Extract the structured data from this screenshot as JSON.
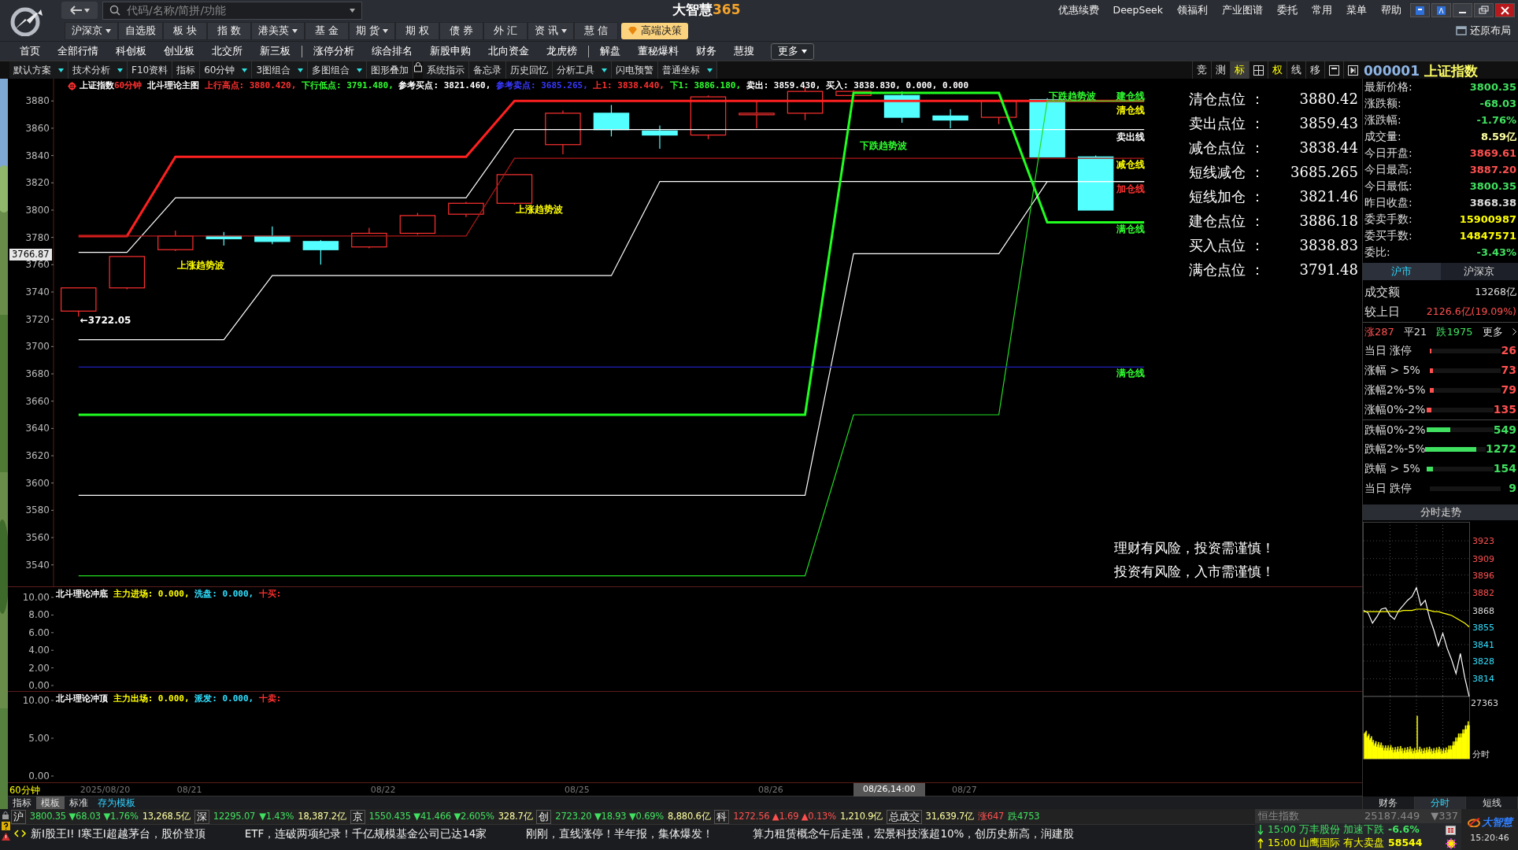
{
  "app_title": "大智慧",
  "app_title_suffix": "365",
  "search": {
    "placeholder": "代码/名称/简拼/功能"
  },
  "top_links": [
    "优惠续费",
    "DeepSeek",
    "领福利",
    "产业图谱",
    "委托",
    "常用",
    "菜单",
    "帮助"
  ],
  "restore_layout": "还原布局",
  "main_menu": [
    {
      "label": "沪深京",
      "dropdown": true
    },
    {
      "label": "自选股",
      "dropdown": false
    },
    {
      "label": "板 块",
      "dropdown": false
    },
    {
      "label": "指 数",
      "dropdown": false
    },
    {
      "label": "港美英",
      "dropdown": true
    },
    {
      "label": "基 金",
      "dropdown": false
    },
    {
      "label": "期 货",
      "dropdown": true
    },
    {
      "label": "期 权",
      "dropdown": false
    },
    {
      "label": "债 券",
      "dropdown": false
    },
    {
      "label": "外 汇",
      "dropdown": false
    },
    {
      "label": "资 讯",
      "dropdown": true
    },
    {
      "label": "慧 信",
      "dropdown": false
    }
  ],
  "premium_button": "高端决策",
  "nav": [
    {
      "kind": "link",
      "label": "首页"
    },
    {
      "kind": "link",
      "label": "全部行情"
    },
    {
      "kind": "link",
      "label": "科创板"
    },
    {
      "kind": "link",
      "label": "创业板"
    },
    {
      "kind": "link",
      "label": "北交所"
    },
    {
      "kind": "link",
      "label": "新三板"
    },
    {
      "kind": "separator"
    },
    {
      "kind": "link",
      "label": "涨停分析"
    },
    {
      "kind": "link",
      "label": "综合排名"
    },
    {
      "kind": "link",
      "label": "新股申购"
    },
    {
      "kind": "link",
      "label": "北向资金"
    },
    {
      "kind": "link",
      "label": "龙虎榜"
    },
    {
      "kind": "separator"
    },
    {
      "kind": "link",
      "label": "解盘"
    },
    {
      "kind": "link",
      "label": "董秘爆料"
    },
    {
      "kind": "link",
      "label": "财务"
    },
    {
      "kind": "link",
      "label": "慧搜"
    }
  ],
  "more_button": "更多",
  "toolbar": [
    {
      "kind": "button",
      "label": "默认方案",
      "dropdown": true
    },
    {
      "kind": "button",
      "label": "技术分析",
      "dropdown": true
    },
    {
      "kind": "button",
      "label": "F10资料",
      "dropdown": false
    },
    {
      "kind": "button",
      "label": "指标",
      "dropdown": false
    },
    {
      "kind": "button",
      "label": "60分钟",
      "dropdown": true
    },
    {
      "kind": "button",
      "label": "3图组合",
      "dropdown": true
    },
    {
      "kind": "button",
      "label": "多图组合",
      "dropdown": true
    },
    {
      "kind": "button",
      "label": "图形叠加",
      "dropdown": false
    },
    {
      "kind": "lock"
    },
    {
      "kind": "button",
      "label": "系统指示",
      "dropdown": false
    },
    {
      "kind": "button",
      "label": "备忘录",
      "dropdown": false
    },
    {
      "kind": "button",
      "label": "历史回忆",
      "dropdown": false
    },
    {
      "kind": "button",
      "label": "分析工具",
      "dropdown": true
    },
    {
      "kind": "button",
      "label": "闪电预警",
      "dropdown": false
    },
    {
      "kind": "button",
      "label": "普通坐标",
      "dropdown": true
    }
  ],
  "view_buttons": [
    {
      "kind": "text",
      "label": "竞",
      "selected": false,
      "active": false
    },
    {
      "kind": "text",
      "label": "测",
      "selected": false,
      "active": false
    },
    {
      "kind": "text",
      "label": "标",
      "selected": true,
      "active": true
    },
    {
      "kind": "grid"
    },
    {
      "kind": "text",
      "label": "权",
      "selected": false,
      "active": true
    },
    {
      "kind": "text",
      "label": "线",
      "selected": false,
      "active": false
    },
    {
      "kind": "text",
      "label": "移",
      "selected": false,
      "active": false
    },
    {
      "kind": "window"
    },
    {
      "kind": "panel"
    }
  ],
  "stock_title": {
    "code": "000001",
    "name": "上证指数"
  },
  "main_chart": {
    "legend": [
      {
        "text": "上证指数",
        "color": "#ffffff"
      },
      {
        "text": "60分钟",
        "color": "#ff3030"
      },
      {
        "text": " 北斗理论主图 ",
        "color": "#ffffff"
      },
      {
        "text": "上行高点: 3880.420, ",
        "color": "#ff3030"
      },
      {
        "text": "下行低点: 3791.480, ",
        "color": "#30ff30"
      },
      {
        "text": "参考买点: 3821.460, ",
        "color": "#ffffff"
      },
      {
        "text": "参考卖点: 3685.265, ",
        "color": "#3838ff"
      },
      {
        "text": "上1: 3838.440, ",
        "color": "#ff3030"
      },
      {
        "text": "下1: 3886.180, ",
        "color": "#30ff30"
      },
      {
        "text": "卖出: 3859.430, ",
        "color": "#ffffff"
      },
      {
        "text": "买入: 3838.830, 0.000, 0.000",
        "color": "#ffffff"
      }
    ],
    "cursor": {
      "price": "3766.87",
      "time": "08/26,14:00"
    },
    "levels": [
      {
        "label": "清仓点位 ：",
        "value": "3880.42"
      },
      {
        "label": "卖出点位 ：",
        "value": "3859.43"
      },
      {
        "label": "减仓点位 ：",
        "value": "3838.44"
      },
      {
        "label": "短线减仓 ：",
        "value": "3685.265"
      },
      {
        "label": "短线加仓 ：",
        "value": "3821.46"
      },
      {
        "label": "建仓点位 ：",
        "value": "3886.18"
      },
      {
        "label": "买入点位 ：",
        "value": "3838.83"
      },
      {
        "label": "满仓点位 ：",
        "value": "3791.48"
      }
    ],
    "time_labels": [
      "2025/08/20",
      "08/21",
      "08/22",
      "08/25",
      "08/26",
      "08/27"
    ],
    "warnings": [
      "理财有风险，投资需谨慎！",
      "投资有风险，入市需谨慎！"
    ],
    "labels": [
      {
        "text": "←3722.05",
        "color": "#ffffff"
      },
      {
        "text": "上涨趋势波",
        "color": "#ffff00"
      },
      {
        "text": "上涨趋势波",
        "color": "#ffff00"
      },
      {
        "text": "下跌趋势波",
        "color": "#30ff30"
      },
      {
        "text": "下跌趋势波",
        "color": "#30ff30"
      },
      {
        "text": "建仓线",
        "color": "#30ff30"
      },
      {
        "text": "清仓线",
        "color": "#ffff00"
      },
      {
        "text": "卖出线",
        "color": "#ffffff"
      },
      {
        "text": "减仓线",
        "color": "#ffff00"
      },
      {
        "text": "加仓线",
        "color": "#ff3030"
      },
      {
        "text": "满仓线",
        "color": "#30ff30"
      },
      {
        "text": "满仓线",
        "color": "#30ff30"
      }
    ],
    "chart_data": {
      "type": "line",
      "categories": [
        null,
        null,
        null,
        null,
        null,
        null,
        null,
        null,
        null,
        null,
        null,
        null,
        null,
        null,
        null,
        null,
        null,
        null,
        null,
        null,
        null,
        null,
        null,
        null,
        null,
        null,
        null
      ],
      "ylim": [
        3523.7,
        3896.3
      ],
      "yticks": [
        3540,
        3560,
        3580,
        3600,
        3620,
        3640,
        3660,
        3680,
        3700,
        3720,
        3740,
        3760,
        3780,
        3800,
        3820,
        3840,
        3860,
        3880
      ],
      "series": [
        {
          "color": "#ff2020",
          "values": [
            3781,
            3781,
            3839,
            3839,
            3839,
            3839,
            3839,
            3839,
            3839,
            3880,
            3880,
            3880,
            3880,
            3880,
            3880,
            3880,
            3880,
            3880,
            3880,
            3880,
            3880,
            3880,
            3880,
            null,
            null,
            null,
            null
          ]
        },
        {
          "color": "#ffffff",
          "values": [
            3769,
            3769,
            3809,
            3809,
            3809,
            3809,
            3809,
            3809,
            3809,
            3859,
            3859,
            3859,
            3859,
            3859,
            3859,
            3859,
            3859,
            3859,
            3859,
            3859,
            3859,
            3859,
            3859,
            null,
            null,
            null,
            null
          ]
        },
        {
          "color": "#b01818",
          "values": [
            3781,
            3781,
            3781,
            3781,
            3781,
            3781,
            3781,
            3781,
            3781,
            3838,
            3838,
            3838,
            3838,
            3838,
            3838,
            3838,
            3838,
            3838,
            3838,
            3838,
            3838,
            3838,
            3838,
            null,
            null,
            null,
            null
          ]
        },
        {
          "color": "#ffffff",
          "values": [
            3705,
            3705,
            3705,
            3705,
            3752,
            3752,
            3752,
            3752,
            3752,
            3752,
            3752,
            3752,
            3821,
            3821,
            3821,
            3821,
            3821,
            3821,
            3821,
            3821,
            3821,
            3821,
            3821,
            null,
            null,
            null,
            null
          ]
        },
        {
          "color": "#20ff20",
          "values": [
            3650,
            3650,
            3650,
            3650,
            3650,
            3650,
            3650,
            3650,
            3650,
            3650,
            3650,
            3650,
            3650,
            3650,
            3650,
            3650,
            3886,
            3886,
            3886,
            3886,
            3791,
            3791,
            3791,
            null,
            null,
            null,
            null
          ]
        },
        {
          "color": "#ffffff",
          "values": [
            3591,
            3591,
            3591,
            3591,
            3591,
            3591,
            3591,
            3591,
            3591,
            3591,
            3591,
            3591,
            3591,
            3591,
            3591,
            3591,
            3768,
            3768,
            3768,
            3768,
            3821,
            3821,
            3821,
            null,
            null,
            null,
            null
          ]
        },
        {
          "color": "#20e020",
          "values": [
            3532,
            3532,
            3532,
            3532,
            3532,
            3532,
            3532,
            3532,
            3532,
            3532,
            3532,
            3532,
            3532,
            3532,
            3532,
            3532,
            3650,
            3650,
            3650,
            3650,
            3880,
            3880,
            3880,
            null,
            null,
            null,
            null
          ]
        },
        {
          "color": "#2020c0",
          "values": [
            3685,
            3685,
            3685,
            3685,
            3685,
            3685,
            3685,
            3685,
            3685,
            3685,
            3685,
            3685,
            3685,
            3685,
            3685,
            3685,
            3685,
            3685,
            3685,
            3685,
            3685,
            3685,
            3685,
            null,
            null,
            null,
            null
          ]
        }
      ]
    }
  },
  "indicators": [
    {
      "legend": [
        {
          "text": "北斗理论冲底 ",
          "color": "#ffffff"
        },
        {
          "text": "主力进场: 0.000, ",
          "color": "#ffff00"
        },
        {
          "text": "洗盘: 0.000, ",
          "color": "#30e0ff"
        },
        {
          "text": "十买:",
          "color": "#ff3030"
        }
      ],
      "axis_labels": [
        "10.00",
        "8.00",
        "6.00",
        "4.00",
        "2.00",
        "0.00"
      ]
    },
    {
      "legend": [
        {
          "text": "北斗理论冲顶 ",
          "color": "#ffffff"
        },
        {
          "text": "主力出场: 0.000, ",
          "color": "#ffff00"
        },
        {
          "text": "派发: 0.000, ",
          "color": "#30e0ff"
        },
        {
          "text": "十卖:",
          "color": "#ff3030"
        }
      ],
      "axis_labels": [
        "10.00",
        "5.00",
        "0.00"
      ]
    }
  ],
  "period_label": "60分钟",
  "bottom_tabs": [
    {
      "kind": "tab",
      "label": "指标",
      "selected": false
    },
    {
      "kind": "tab",
      "label": "模板",
      "selected": true
    },
    {
      "kind": "tab",
      "label": "标准",
      "selected": false
    },
    {
      "kind": "link",
      "label": "存为模板",
      "selected": false
    }
  ],
  "quote": [
    {
      "label": "最新价格:",
      "value": "3800.35",
      "color": "#40e060"
    },
    {
      "label": "涨跌额:",
      "value": "-68.03",
      "color": "#40e060"
    },
    {
      "label": "涨跌幅:",
      "value": "-1.76%",
      "color": "#40e060"
    },
    {
      "label": "成交量:",
      "value": "8.59亿",
      "color": "#ffffa0"
    },
    {
      "label": "今日开盘:",
      "value": "3869.61",
      "color": "#ff5050"
    },
    {
      "label": "今日最高:",
      "value": "3887.20",
      "color": "#ff5050"
    },
    {
      "label": "今日最低:",
      "value": "3800.35",
      "color": "#40e060"
    },
    {
      "label": "昨日收盘:",
      "value": "3868.38",
      "color": "#dddddd"
    },
    {
      "label": "委卖手数:",
      "value": "15900987",
      "color": "#ffff00"
    },
    {
      "label": "委买手数:",
      "value": "14847571",
      "color": "#ffff00"
    },
    {
      "label": "委比:",
      "value": "-3.43%",
      "color": "#40e060"
    }
  ],
  "market_tabs": [
    {
      "label": "沪市",
      "selected": true
    },
    {
      "label": "沪深京",
      "selected": false
    }
  ],
  "turnover": [
    {
      "label": "成交额",
      "value": "13268亿",
      "color": "#dddddd"
    },
    {
      "label": "较上日",
      "value": "2126.6亿(19.09%)",
      "color": "#ff5050"
    }
  ],
  "breadth_summary": [
    {
      "text": "涨287",
      "color": "#ff5050"
    },
    {
      "text": "平21",
      "color": "#dddddd"
    },
    {
      "text": "跌1975",
      "color": "#40e060"
    }
  ],
  "breadth_more": "更多",
  "breadth": [
    {
      "label": "当日 涨停",
      "count": "26",
      "level": 0.02,
      "color": "#ff5050"
    },
    {
      "label": "涨幅 > 5%",
      "count": "73",
      "level": 0.04,
      "color": "#ff5050"
    },
    {
      "label": "涨幅2%-5%",
      "count": "79",
      "level": 0.05,
      "color": "#ff5050"
    },
    {
      "label": "涨幅0%-2%",
      "count": "135",
      "level": 0.08,
      "color": "#ff5050"
    },
    {
      "label": "跌幅0%-2%",
      "count": "549",
      "level": 0.36,
      "color": "#40e060"
    },
    {
      "label": "跌幅2%-5%",
      "count": "1272",
      "level": 0.84,
      "color": "#40e060"
    },
    {
      "label": "跌幅 > 5%",
      "count": "154",
      "level": 0.1,
      "color": "#40e060"
    },
    {
      "label": "当日 跌停",
      "count": "9",
      "color": "#40e060"
    }
  ],
  "intraday": {
    "title": "分时走势",
    "volume_label": "27363",
    "time_label": "分时",
    "chart_data": {
      "type": "line",
      "categories": [
        null,
        null,
        null,
        null,
        null,
        null,
        null,
        null,
        null,
        null,
        null,
        null,
        null,
        null,
        null,
        null,
        null,
        null,
        null,
        null,
        null,
        null,
        null,
        null,
        null
      ],
      "grid": true,
      "ylim": [
        3800,
        3938
      ],
      "yticks": [
        3814,
        3828,
        3841,
        3855,
        3868,
        3882,
        3896,
        3909,
        3923
      ],
      "series": [
        {
          "color": "#ffffff",
          "values": [
            3868,
            3866,
            3858,
            3863,
            3869,
            3870,
            3864,
            3861,
            3868,
            3872,
            3876,
            3879,
            3886,
            3872,
            3876,
            3862,
            3852,
            3840,
            3850,
            3838,
            3829,
            3818,
            3834,
            3815,
            3800
          ]
        },
        {
          "color": "#ffff00",
          "values": [
            3867,
            3867,
            3867,
            3867,
            3867,
            3867,
            3867,
            3867,
            3867,
            3868,
            3868,
            3868,
            3869,
            3869,
            3869,
            3868,
            3867,
            3867,
            3866,
            3865,
            3864,
            3862,
            3860,
            3858,
            3855
          ]
        }
      ]
    }
  },
  "side_tabs": [
    {
      "label": "财务",
      "selected": false
    },
    {
      "label": "分时",
      "selected": true
    },
    {
      "label": "短线",
      "selected": false
    }
  ],
  "status_bar": [
    {
      "kind": "market",
      "text": "沪"
    },
    {
      "kind": "value",
      "text": "3800.35 ▼68.03 ▼1.76%",
      "color": "#40e060"
    },
    {
      "kind": "value",
      "text": "13,268.5亿",
      "color": "#ffffa0"
    },
    {
      "kind": "market",
      "text": "深"
    },
    {
      "kind": "value",
      "text": "12295.07",
      "color": "#40e060"
    },
    {
      "kind": "value",
      "text": "▼1.43%",
      "color": "#40e060"
    },
    {
      "kind": "value",
      "text": "18,387.2亿",
      "color": "#ffffa0"
    },
    {
      "kind": "market",
      "text": "京"
    },
    {
      "kind": "value",
      "text": "1550.435 ▼41.466 ▼2.605%",
      "color": "#40e060"
    },
    {
      "kind": "value",
      "text": "328.7亿",
      "color": "#ffffa0"
    },
    {
      "kind": "market",
      "text": "创"
    },
    {
      "kind": "value",
      "text": "2723.20 ▼18.93 ▼0.69%",
      "color": "#40e060"
    },
    {
      "kind": "value",
      "text": "8,880.6亿",
      "color": "#ffffa0"
    },
    {
      "kind": "market",
      "text": "科"
    },
    {
      "kind": "value",
      "text": "1272.56 ▲1.69 ▲0.13%",
      "color": "#ff5050"
    },
    {
      "kind": "value",
      "text": "1,210.9亿",
      "color": "#ffffa0"
    },
    {
      "kind": "market",
      "text": "总成交"
    },
    {
      "kind": "value",
      "text": "31,639.7亿",
      "color": "#ffffa0"
    },
    {
      "kind": "value",
      "text": "涨647",
      "color": "#ff5050"
    },
    {
      "kind": "value",
      "text": "跌4753",
      "color": "#40e060"
    }
  ],
  "ticker": [
    "新I股王I! I寒王I超越茅台，股价登顶",
    "ETF，连破两项纪录！千亿规模基金公司已达14家",
    "刚刚，直线涨停！半年报，集体爆发！",
    "算力租赁概念午后走强，宏景科技涨超10%，创历史新高，润建股"
  ],
  "index_quote": {
    "name": "恒生指数",
    "value": "25187.449",
    "change": "▼337"
  },
  "alerts": [
    {
      "rising": false,
      "text": "15:00 万丰股份 加速下跌",
      "value": "-6.6%",
      "color": "#40e060"
    },
    {
      "rising": true,
      "text": "15:00 山鹰国际 有大卖盘",
      "value": "58544",
      "color": "#ffff00"
    }
  ],
  "brand": "大智慧",
  "clock": "15:20:46"
}
